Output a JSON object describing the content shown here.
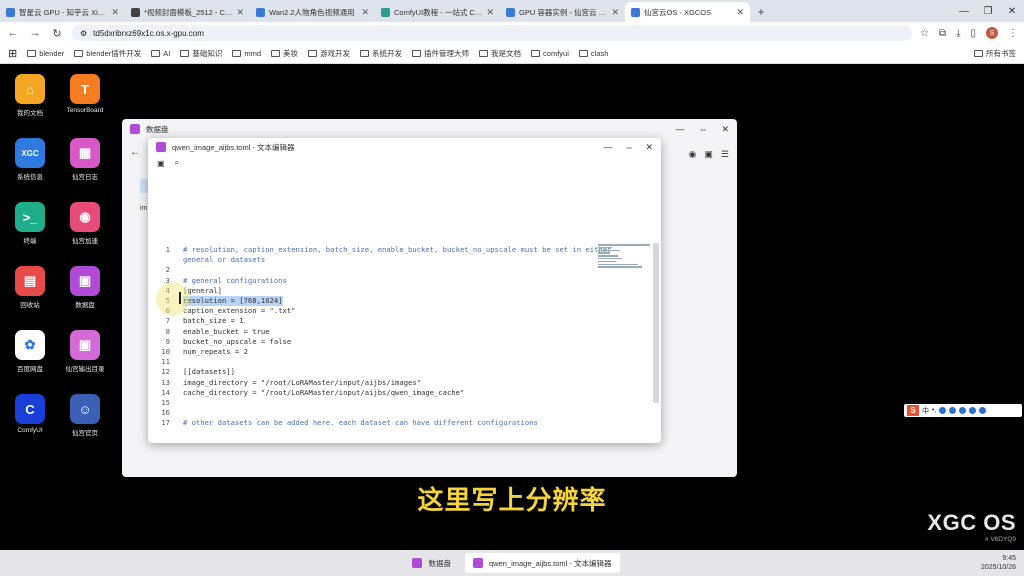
{
  "browser": {
    "tabs": [
      {
        "title": "智星云 GPU - 知乎云 Xiangong",
        "color": "#3b7bd8",
        "active": false
      },
      {
        "title": "*视频封面模板_2512 - Comfy",
        "color": "#444444",
        "active": false
      },
      {
        "title": "Wan2.2人物角色视频通用",
        "color": "#3b7bd8",
        "active": false
      },
      {
        "title": "ComfyUI教程 - 一站式 Com",
        "color": "#2a9d8f",
        "active": false
      },
      {
        "title": "GPU 容器实例 - 仙宫云 Xiang",
        "color": "#3b7bd8",
        "active": false
      },
      {
        "title": "仙宫云OS - XGCOS",
        "color": "#3b7bd8",
        "active": true
      }
    ],
    "new_tab": "+",
    "url": "td5dxribrxz69x1c.os.x-gpu.com",
    "bookmarks": [
      "blender",
      "blender插件开发",
      "AI",
      "基础知识",
      "mmd",
      "美妆",
      "游戏开发",
      "系统开发",
      "插件管理大师",
      "我是文档",
      "comfyui",
      "clash"
    ],
    "bookmarks_end": "所有书签"
  },
  "desktop": {
    "icons": [
      {
        "label": "我的文档",
        "glyph": "⌂",
        "color": "#f5a623"
      },
      {
        "label": "TensorBoard",
        "glyph": "T",
        "color": "#f57c20"
      },
      {
        "label": "XGC",
        "glyph": "XGC",
        "color": "#2d7be0",
        "sub": "系统信息"
      },
      {
        "label": "仙宫日志",
        "glyph": "▦",
        "color": "#d958c8"
      },
      {
        "label": "终端",
        "glyph": ">_",
        "color": "#1fae8a"
      },
      {
        "label": "仙宫加速",
        "glyph": "◉",
        "color": "#e64b7a"
      },
      {
        "label": "回收站",
        "glyph": "▤",
        "color": "#e84a4a"
      },
      {
        "label": "数据盘",
        "glyph": "▣",
        "color": "#b24ad8"
      },
      {
        "label": "百度网盘",
        "glyph": "✿",
        "color": "#ffffff"
      },
      {
        "label": "仙宫输出目录",
        "glyph": "▣",
        "color": "#d46ad8"
      },
      {
        "label": "ComfyUI",
        "glyph": "C",
        "color": "#1a3fd8"
      },
      {
        "label": "仙宫官页",
        "glyph": "☺",
        "color": "#3a5fb5"
      }
    ],
    "brand": "XGC OS",
    "brand_version": "# V6DYQ9",
    "ime_label": "中"
  },
  "file_window": {
    "title": "数据盘",
    "side_label": "im"
  },
  "editor_window": {
    "title": "qwen_image_aijbs.toml - 文本编辑器",
    "lines": [
      {
        "n": "1",
        "text": "# resolution, caption_extension, batch_size, enable_bucket, bucket_no_upscale must be set in either",
        "kind": "cmt"
      },
      {
        "n": "",
        "text": "general or datasets",
        "kind": "cmt"
      },
      {
        "n": "2",
        "text": "",
        "kind": "code"
      },
      {
        "n": "3",
        "text": "# general configurations",
        "kind": "cmt"
      },
      {
        "n": "4",
        "text": "[general]",
        "kind": "code"
      },
      {
        "n": "5",
        "text": "resolution = [768,1024]",
        "kind": "hl"
      },
      {
        "n": "6",
        "text": "caption_extension = \".txt\"",
        "kind": "code"
      },
      {
        "n": "7",
        "text": "batch_size = 1",
        "kind": "code"
      },
      {
        "n": "8",
        "text": "enable_bucket = true",
        "kind": "code"
      },
      {
        "n": "9",
        "text": "bucket_no_upscale = false",
        "kind": "code"
      },
      {
        "n": "10",
        "text": "num_repeats = 2",
        "kind": "code"
      },
      {
        "n": "11",
        "text": "",
        "kind": "code"
      },
      {
        "n": "12",
        "text": "[[datasets]]",
        "kind": "code"
      },
      {
        "n": "13",
        "text": "image_directory = \"/root/LoRAMaster/input/aijbs/images\"",
        "kind": "code"
      },
      {
        "n": "14",
        "text": "cache_directory = \"/root/LoRAMaster/input/aijbs/qwen_image_cache\"",
        "kind": "code"
      },
      {
        "n": "15",
        "text": "",
        "kind": "code"
      },
      {
        "n": "16",
        "text": "",
        "kind": "code"
      },
      {
        "n": "17",
        "text": "# other datasets can be added here. each dataset can have different configurations",
        "kind": "cmt"
      }
    ]
  },
  "subtitle": "这里写上分辨率",
  "taskbar": {
    "items": [
      {
        "label": "数据盘",
        "active": false
      },
      {
        "label": "qwen_image_aijbs.toml - 文本编辑器",
        "active": true
      }
    ],
    "time": "9:45",
    "date": "2025/10/26"
  },
  "colors": {
    "accent": "#b24ad8",
    "selection": "#b9d4f6",
    "subtitle": "#f5d33a"
  }
}
